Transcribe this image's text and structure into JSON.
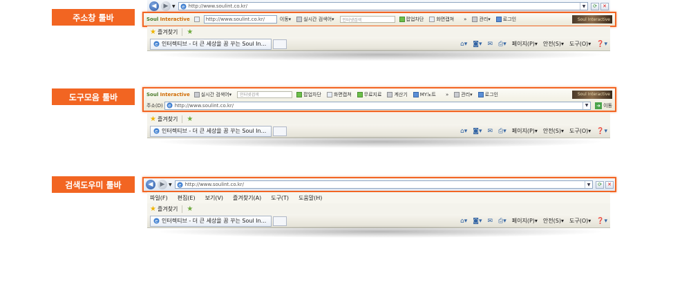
{
  "labels": {
    "address_bar": "주소창 툴바",
    "toolbar_bar": "도구모음 툴바",
    "search_bar": "검색도우미 툴바"
  },
  "browser": {
    "url": "http://www.soulint.co.kr/",
    "tab_title": "인터렉티브 - 더 큰 세상을 꿈 꾸는 Soul In...",
    "favorites_label": "즐겨찾기",
    "address_label": "주소(D)",
    "go_label": "이동"
  },
  "commands": {
    "page": "페이지(P)",
    "safety": "안전(S)",
    "tools": "도구(O)"
  },
  "toolbar": {
    "brand_a": "Soul",
    "brand_b": "Interactive",
    "move_label": "이동",
    "realtime_search": "실시간 검색어",
    "search_placeholder": "인터넷검색",
    "popup_block": "팝업차단",
    "screen_capture": "화면캡쳐",
    "free_dict": "무료지료",
    "calculator": "계산기",
    "my_note": "MY노트",
    "manage": "관리",
    "login": "로그인",
    "more": "»",
    "banner_text": "Soul Interactive"
  },
  "menu": [
    "파일(F)",
    "편집(E)",
    "보기(V)",
    "즐겨찾기(A)",
    "도구(T)",
    "도움말(H)"
  ],
  "colors": {
    "accent": "#f26522",
    "nav_bg": "#dfe6f0",
    "toolbar_bg": "#ece9d8"
  }
}
